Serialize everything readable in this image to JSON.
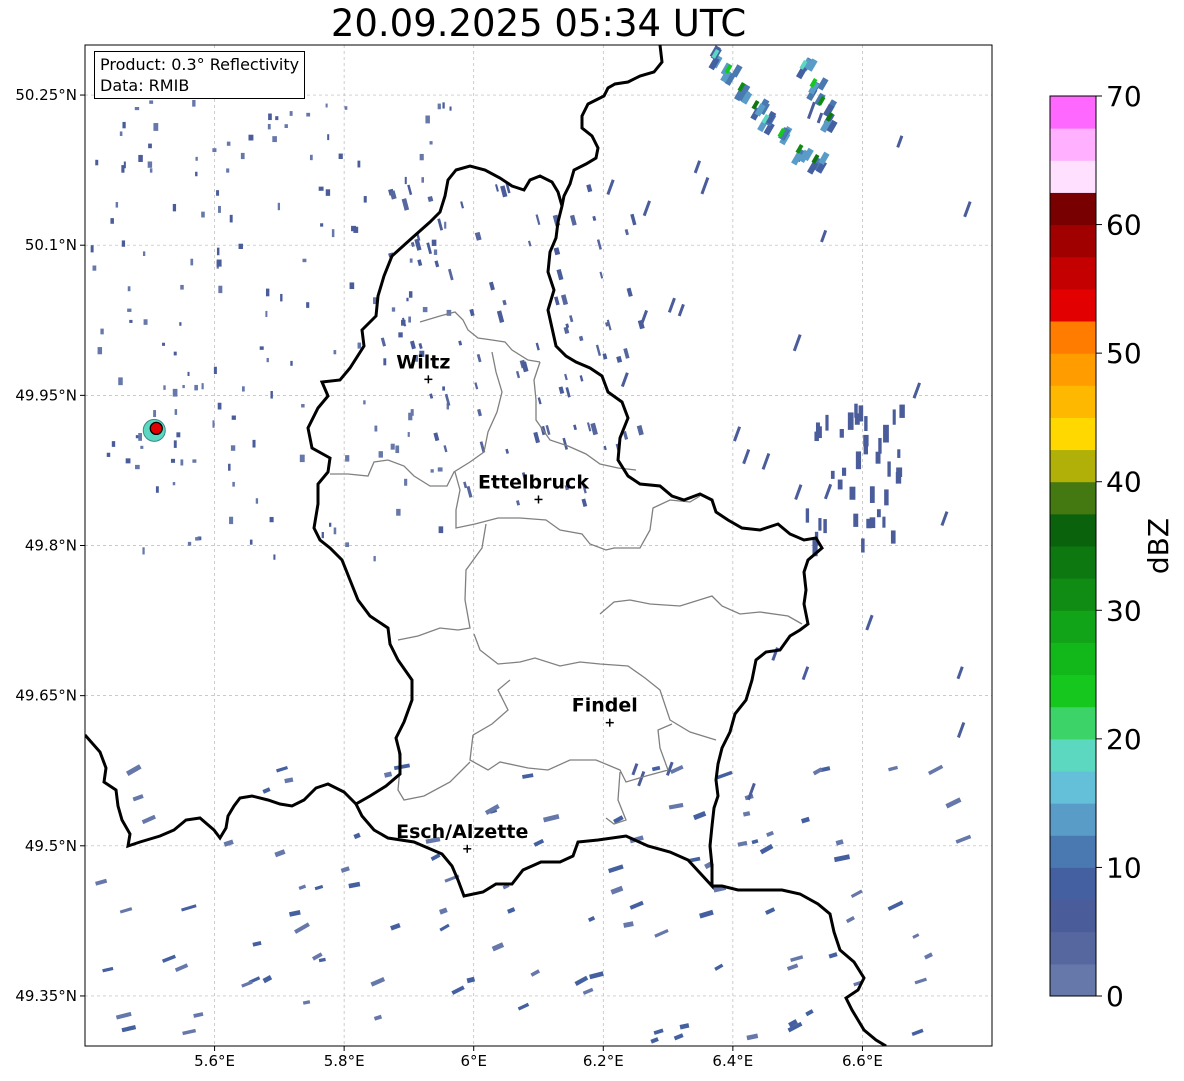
{
  "title": "20.09.2025 05:34 UTC",
  "info": {
    "product": "Product: 0.3° Reflectivity",
    "data_source": "Data: RMIB"
  },
  "axes": {
    "lon_ticks": [
      "5.6°E",
      "5.8°E",
      "6°E",
      "6.2°E",
      "6.4°E",
      "6.6°E"
    ],
    "lat_ticks": [
      "50.25°N",
      "50.1°N",
      "49.95°N",
      "49.8°N",
      "49.65°N",
      "49.5°N",
      "49.35°N"
    ],
    "extent": {
      "lon_min": 5.4,
      "lon_max": 6.8,
      "lat_min": 49.3,
      "lat_max": 50.3
    },
    "gridlines": true
  },
  "cities": [
    {
      "name": "Wiltz",
      "lon": 5.93,
      "lat": 49.966
    },
    {
      "name": "Ettelbruck",
      "lon": 6.1,
      "lat": 49.846
    },
    {
      "name": "Findel",
      "lon": 6.21,
      "lat": 49.623
    },
    {
      "name": "Esch/Alzette",
      "lon": 5.99,
      "lat": 49.497
    }
  ],
  "radar_site": {
    "lon": 5.51,
    "lat": 49.915
  },
  "colorbar": {
    "label": "dBZ",
    "ticks": [
      "0",
      "10",
      "20",
      "30",
      "40",
      "50",
      "60",
      "70"
    ],
    "min": 0,
    "max": 70,
    "step": 2.5,
    "colors": [
      "#6677aa",
      "#56669e",
      "#4a5c9a",
      "#4560a0",
      "#4a78b0",
      "#5a9cc8",
      "#64c0d8",
      "#5cd8c0",
      "#3cd468",
      "#16c81e",
      "#12b81a",
      "#12a418",
      "#108c14",
      "#0e7810",
      "#0a620c",
      "#447810",
      "#b0b008",
      "#ffd800",
      "#ffb800",
      "#ff9c00",
      "#ff7c00",
      "#e20000",
      "#c40000",
      "#a00000",
      "#780000",
      "#ffe0ff",
      "#ffb0ff",
      "#ff68ff",
      "#e83ee8"
    ]
  }
}
